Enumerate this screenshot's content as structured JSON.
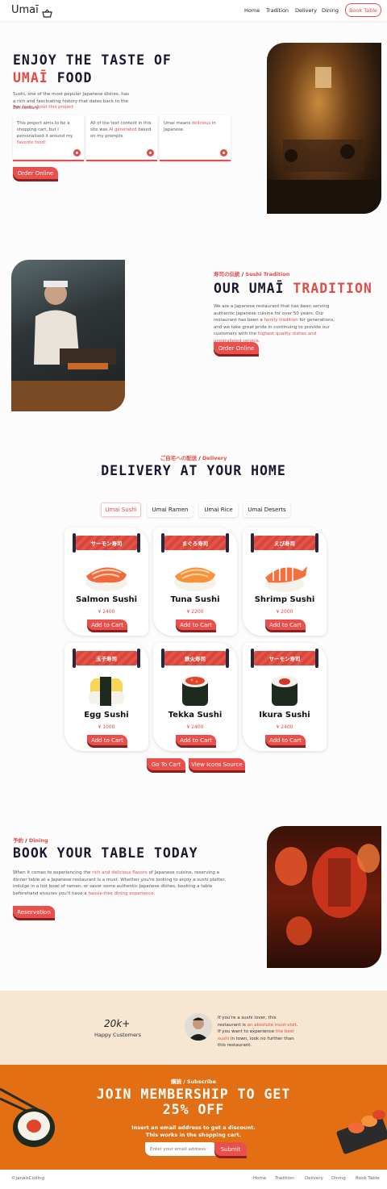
{
  "brand": {
    "name": "Umaī"
  },
  "nav": {
    "links": [
      "Home",
      "Tradition",
      "Delivery",
      "Dining"
    ],
    "book_button": "Book Table"
  },
  "hero": {
    "title_line1": "ENJOY THE TASTE OF",
    "title_highlight": "UMAĪ",
    "title_rest": "FOOD",
    "desc": "Sushi, one of the most popular Japanese dishes, has a rich and fascinating history that dates back to the 8th century.",
    "link": "Fun facts about this project",
    "features": [
      {
        "pre": "This project aims to be a shopping cart, but I personalised it around my ",
        "hl": "favorite food!",
        "post": ""
      },
      {
        "pre": "All of the text content in this site was ",
        "hl": "AI generated",
        "post": " based on my prompts."
      },
      {
        "pre": "Umai means ",
        "hl": "delicious",
        "post": " in Japanese."
      }
    ],
    "order_button": "Order Online"
  },
  "tradition": {
    "kicker_jp": "寿司の伝統",
    "kicker_en": "Sushi Tradition",
    "title_a": "OUR UMAĪ",
    "title_b": "TRADITION",
    "p1": "We are a Japanese restaurant that has been serving authentic Japanese cuisine for over 50 years. Our restaurant has been a ",
    "hl1": "family tradition",
    "p2": " for generations, and we take great pride in continuing to provide our customers with the ",
    "hl2": "highest quality dishes and unparalleled service",
    "p3": ".",
    "order_button": "Order Online"
  },
  "delivery": {
    "kicker_jp": "ご自宅への配送",
    "kicker_en": "Delivery",
    "title": "DELIVERY AT YOUR HOME",
    "tabs": [
      "Umai Sushi",
      "Umai Ramen",
      "Umai Rice",
      "Umai Deserts"
    ],
    "add_label": "Add to Cart",
    "items": [
      {
        "banner": "サーモン寿司",
        "name": "Salmon Sushi",
        "price": "¥ 2400"
      },
      {
        "banner": "まぐろ寿司",
        "name": "Tuna Sushi",
        "price": "¥ 2200"
      },
      {
        "banner": "えび寿司",
        "name": "Shrimp Sushi",
        "price": "¥ 2000"
      },
      {
        "banner": "玉子寿司",
        "name": "Egg Sushi",
        "price": "¥ 1000"
      },
      {
        "banner": "鉄火寿司",
        "name": "Tekka Sushi",
        "price": "¥ 2400"
      },
      {
        "banner": "サーモン寿司",
        "name": "Ikura Sushi",
        "price": "¥ 2400"
      }
    ],
    "go_cart": "Go To Cart",
    "icons_source": "View Icons Source"
  },
  "dining": {
    "kicker_jp": "予約",
    "kicker_en": "Dining",
    "title": "BOOK YOUR TABLE TODAY",
    "p1": "When it comes to experiencing the ",
    "hl1": "rich and delicious flavors",
    "p2": " of Japanese cuisine, reserving a dinner table at a Japanese restaurant is a must. Whether you're looking to enjoy a sushi platter, indulge in a hot bowl of ramen, or savor some authentic Japanese dishes, booking a table beforehand ensures you'll have a ",
    "hl2": "hassle-free dining experience",
    "p3": ".",
    "reserve_button": "Reservation"
  },
  "testimonial": {
    "stat": "20k+",
    "stat_label": "Happy Customers",
    "q1": "If you're a sushi lover, this restaurant is ",
    "qh1": "an absolute must-visit",
    "q2": ". If you want to experience ",
    "qh2": "the best sushi",
    "q3": " in town, look no further than this restaurant."
  },
  "subscribe": {
    "kicker_jp": "購読",
    "kicker_en": "Subscribe",
    "title1": "JOIN MEMBERSHIP TO GET",
    "title2": "25% OFF",
    "desc1": "Insert an email address to get a discount.",
    "desc2": "This works in the shopping cart.",
    "placeholder": "Enter your email address",
    "submit": "Submit"
  },
  "footer": {
    "credit": "©JanalsCoding",
    "links": [
      "Home",
      "Tradition",
      "Delivery",
      "Dining",
      "Book Table"
    ]
  },
  "colors": {
    "accent": "#ea4f4b",
    "dark": "#1a1830",
    "subscribe_bg": "#e26f13",
    "testimonial_bg": "#f6e6d2"
  }
}
